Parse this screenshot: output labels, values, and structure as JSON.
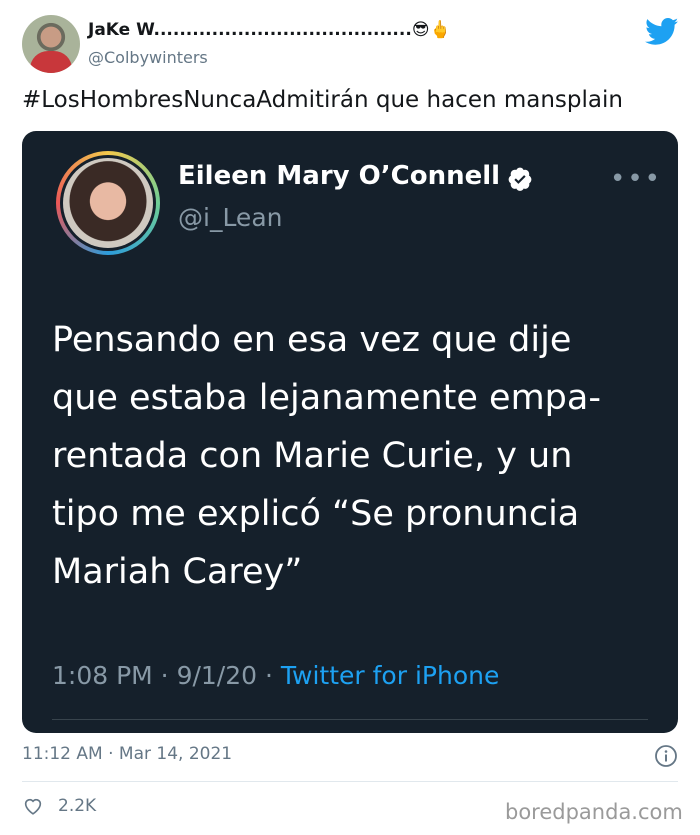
{
  "tweet": {
    "author_name": "JaKe W........................................",
    "author_emoji": "😎🖕",
    "handle": "@Colbywinters",
    "text": "#LosHombresNuncaAdmitirán que hacen mansplain",
    "timestamp": "11:12 AM · Mar 14, 2021",
    "likes": "2.2K"
  },
  "embedded": {
    "author_name": "Eileen Mary O’Connell",
    "handle": "@i_Lean",
    "text": "Pensando en esa vez que dije\nque estaba lejanamente empa-\nrentada con Marie Curie, y un\ntipo me explicó “Se pronuncia\nMariah Carey”",
    "time": "1:08 PM · 9/1/20 · ",
    "source": "Twitter for iPhone"
  },
  "watermark": "boredpanda.com",
  "icons": {
    "twitter": "twitter-bird-icon",
    "verified": "verified-badge-icon",
    "more": "more-options-icon",
    "info": "info-icon",
    "like": "heart-icon"
  },
  "colors": {
    "twitter_blue": "#1da1f2",
    "card_bg": "#15202b",
    "secondary_text": "#657786"
  }
}
